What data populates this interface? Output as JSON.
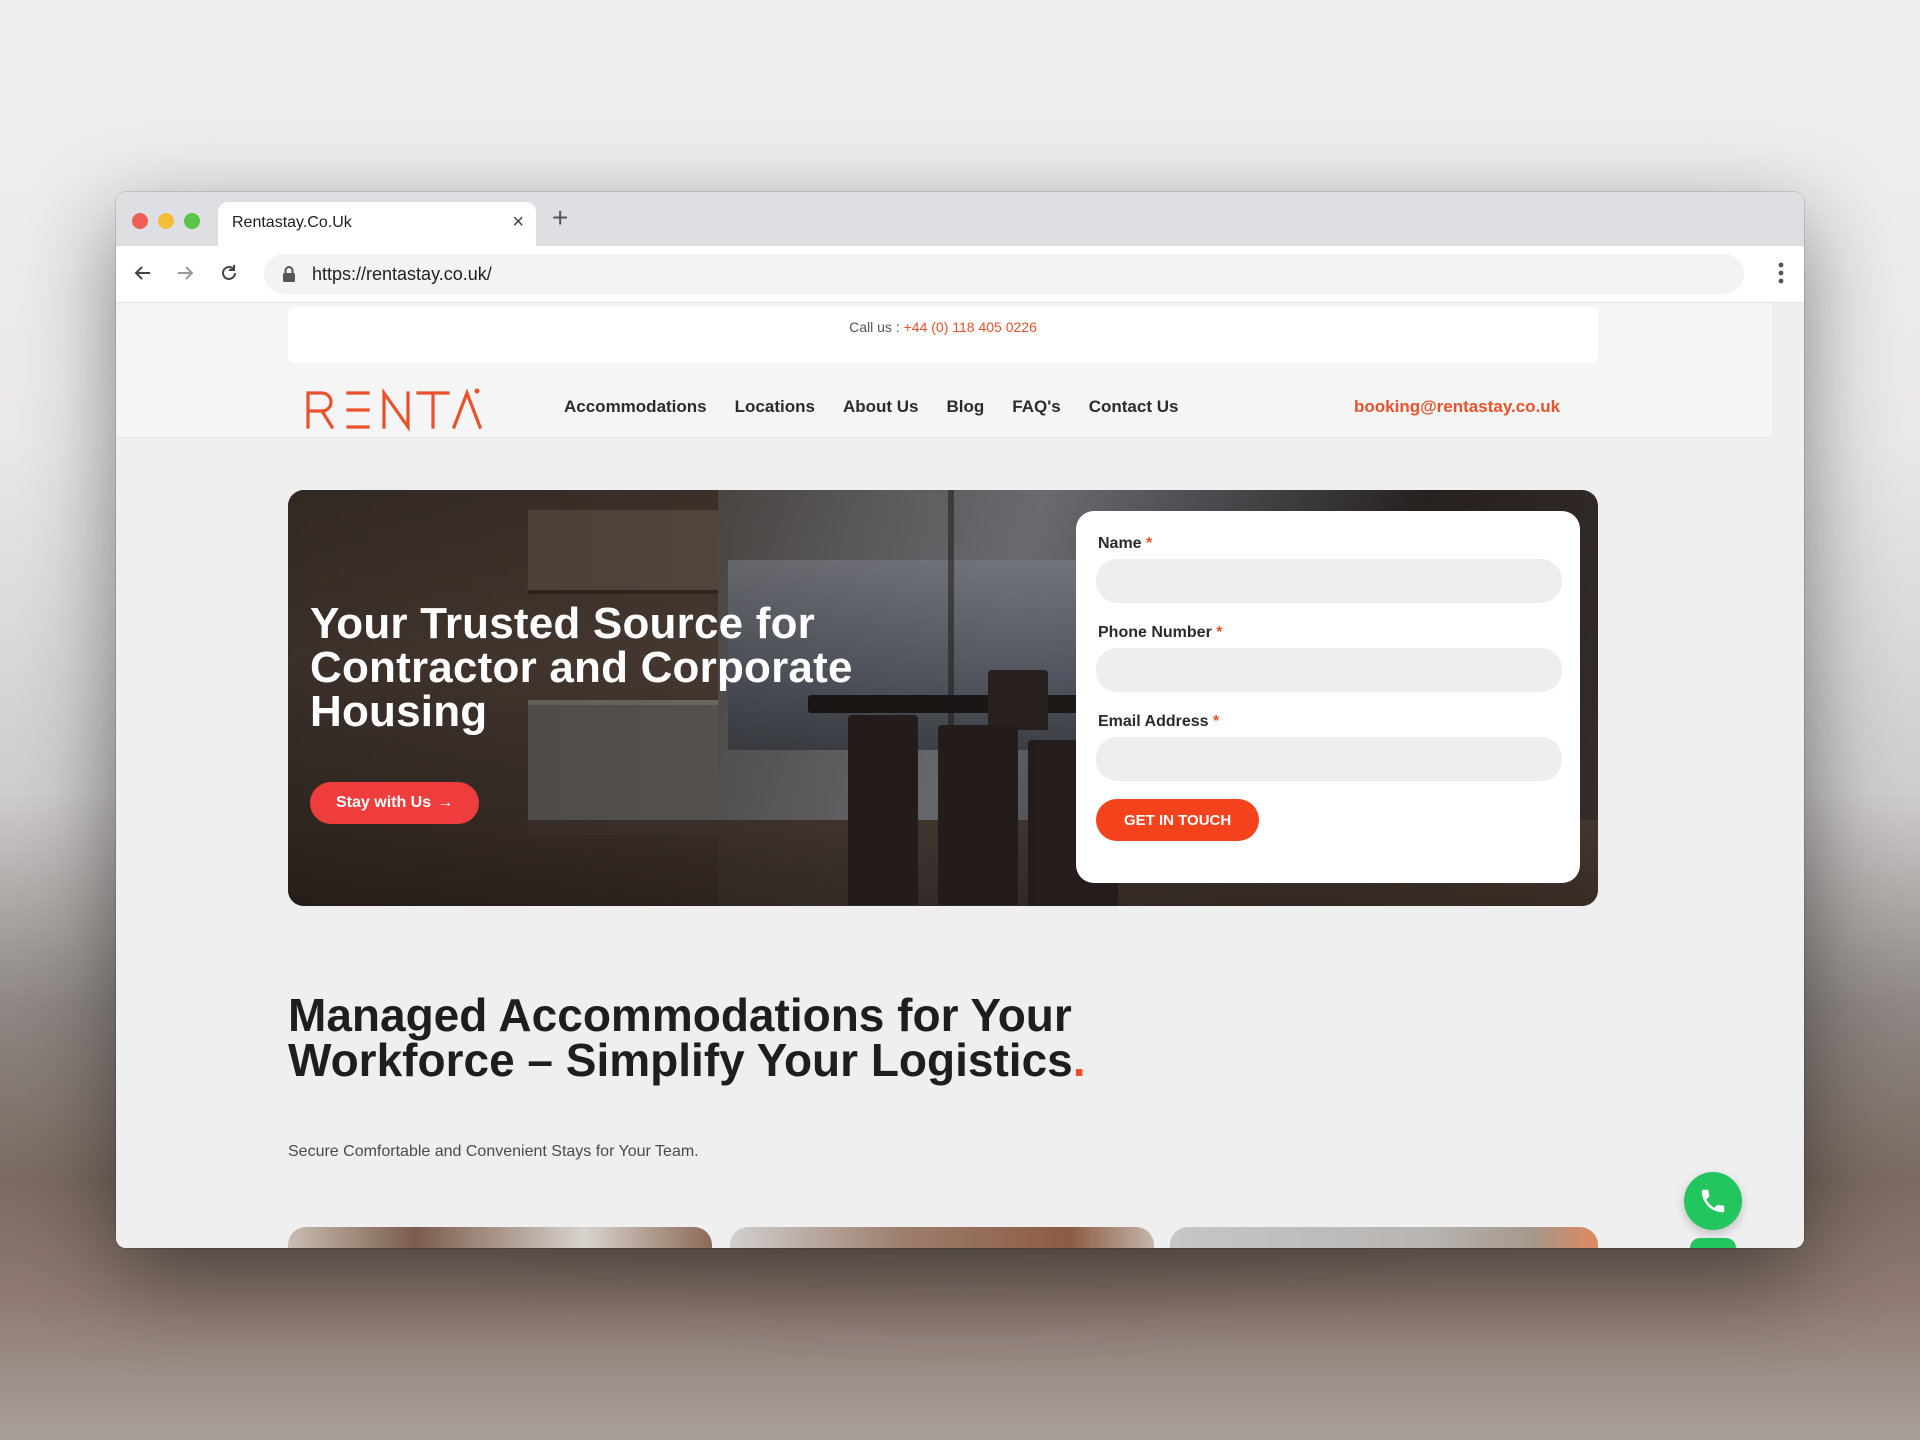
{
  "browser": {
    "tab_title": "Rentastay.Co.Uk",
    "tab_close": "×",
    "new_tab": "+",
    "url": "https://rentastay.co.uk/"
  },
  "callbar": {
    "label": "Call us : ",
    "phone": "+44 (0) 118 405 0226"
  },
  "header": {
    "logo": "RENTA",
    "nav": [
      "Accommodations",
      "Locations",
      "About Us",
      "Blog",
      "FAQ's",
      "Contact Us"
    ],
    "email": "booking@rentastay.co.uk"
  },
  "hero": {
    "title": "Your Trusted Source for Contractor and Corporate Housing",
    "cta": "Stay with Us",
    "cta_arrow": "→"
  },
  "form": {
    "fields": [
      {
        "label": "Name",
        "required": "*"
      },
      {
        "label": "Phone Number",
        "required": "*"
      },
      {
        "label": "Email Address",
        "required": "*"
      }
    ],
    "submit": "GET IN TOUCH"
  },
  "section": {
    "title": "Managed Accommodations for Your Workforce – Simplify Your Logistics",
    "title_dot": ".",
    "subtitle": "Secure Comfortable and Convenient Stays for Your Team."
  },
  "colors": {
    "accent": "#e9512a",
    "button": "#f4431c",
    "hero_cta": "#ef3d3d",
    "whatsapp": "#22c55e"
  }
}
